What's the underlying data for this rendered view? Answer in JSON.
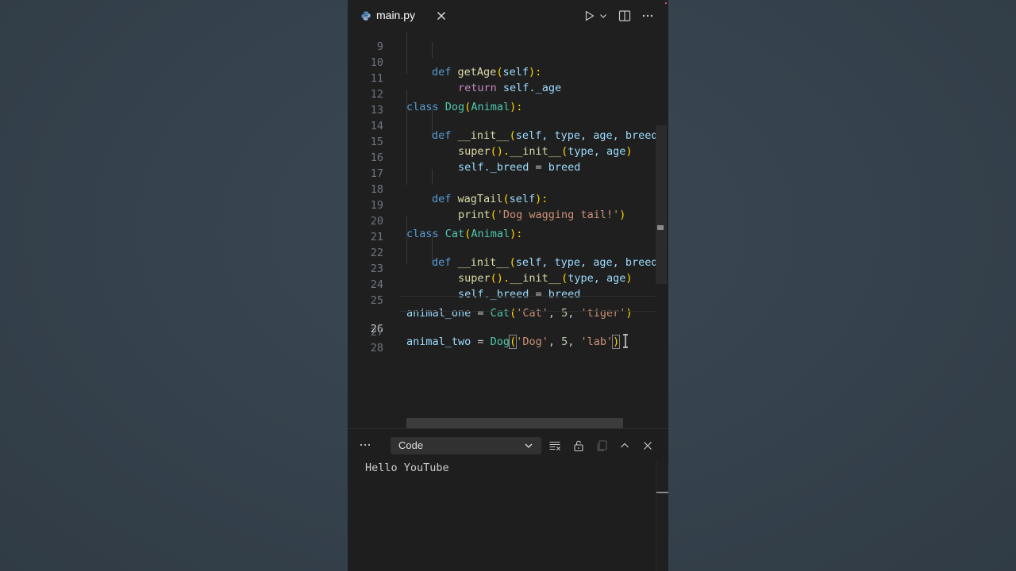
{
  "tab": {
    "label": "main.py"
  },
  "code_lines": [
    {
      "num": "9"
    },
    {
      "num": "10"
    },
    {
      "num": "11"
    },
    {
      "num": "12"
    },
    {
      "num": "13"
    },
    {
      "num": "14"
    },
    {
      "num": "15"
    },
    {
      "num": "16"
    },
    {
      "num": "17"
    },
    {
      "num": "18"
    },
    {
      "num": "19"
    },
    {
      "num": "20"
    },
    {
      "num": "21"
    },
    {
      "num": "22"
    },
    {
      "num": "23"
    },
    {
      "num": "24"
    },
    {
      "num": "25"
    },
    {
      "num": "26"
    },
    {
      "num": "27"
    },
    {
      "num": "28"
    }
  ],
  "code": {
    "l9": {
      "kw": "def",
      "fn": "getAge",
      "p1": "(",
      "self": "self",
      "p2": "):"
    },
    "l10": {
      "kw": "return",
      "var": "self._age"
    },
    "l12": {
      "kw": "class",
      "cls": "Dog",
      "p1": "(",
      "base": "Animal",
      "p2": "):"
    },
    "l13": {
      "kw": "def",
      "fn": "__init__",
      "p1": "(",
      "args": "self, type, age, breed",
      "p2": "):"
    },
    "l14": {
      "fn": "super",
      "p1": "().",
      "fn2": "__init__",
      "p2": "(",
      "args": "type, age",
      "p3": ")"
    },
    "l15": {
      "var": "self._breed",
      "op": " = ",
      "val": "breed"
    },
    "l17": {
      "kw": "def",
      "fn": "wagTail",
      "p1": "(",
      "args": "self",
      "p2": "):"
    },
    "l18": {
      "fn": "print",
      "p1": "(",
      "str": "'Dog wagging tail!'",
      "p2": ")"
    },
    "l20": {
      "kw": "class",
      "cls": "Cat",
      "p1": "(",
      "base": "Animal",
      "p2": "):"
    },
    "l21": {
      "kw": "def",
      "fn": "__init__",
      "p1": "(",
      "args": "self, type, age, breed",
      "p2": "):"
    },
    "l22": {
      "fn": "super",
      "p1": "().",
      "fn2": "__init__",
      "p2": "(",
      "args": "type, age",
      "p3": ")"
    },
    "l23": {
      "var": "self._breed",
      "op": " = ",
      "val": "breed"
    },
    "l25": {
      "var": "animal_one",
      "op": " = ",
      "cls": "Cat",
      "p1": "(",
      "s1": "'Cat'",
      "c1": ", ",
      "n": "5",
      "c2": ", ",
      "s2": "'tiger'",
      "p2": ")"
    },
    "l26": {
      "var": "animal_two",
      "op": " = ",
      "cls": "Dog",
      "p1": "(",
      "s1": "'Dog'",
      "c1": ", ",
      "n": "5",
      "c2": ", ",
      "s2": "'lab'",
      "p2": ")"
    }
  },
  "panel": {
    "output_channel": "Code",
    "output_text": "Hello YouTube"
  },
  "colors": {
    "editor_bg": "#1f1f1f",
    "keyword": "#569cd6",
    "class": "#4ec9b0",
    "function": "#dcdcaa",
    "variable": "#9cdcfe",
    "string": "#ce9178",
    "number": "#b5cea8"
  },
  "icons": [
    "python-icon",
    "close-icon",
    "run-icon",
    "chevron-down-icon",
    "split-editor-icon",
    "more-icon",
    "clear-output-icon",
    "lock-icon",
    "copy-icon",
    "maximize-icon"
  ]
}
